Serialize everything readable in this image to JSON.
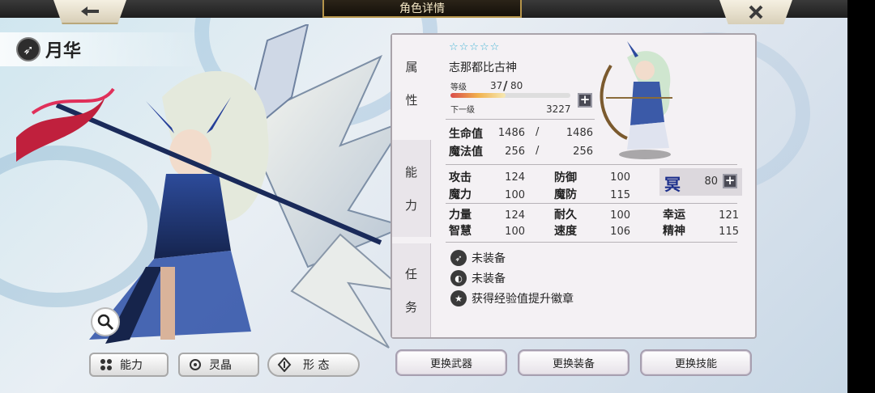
{
  "header": {
    "title": "角色详情",
    "back_icon": "arrow-left-icon",
    "close_icon": "close-icon"
  },
  "character": {
    "name": "月华",
    "class_icon": "bow-class-icon",
    "stars": "☆☆☆☆☆",
    "title": "志那都比古神",
    "level_label": "等级",
    "level": "37",
    "level_sep": "/",
    "level_max": "80",
    "next_label": "下一级",
    "next_exp": "3227",
    "exp_progress": 0.46
  },
  "vitals": {
    "hp_label": "生命值",
    "hp": "1486",
    "hp_sep": "/",
    "hp_max": "1486",
    "mp_label": "魔法值",
    "mp": "256",
    "mp_sep": "/",
    "mp_max": "256"
  },
  "stats": {
    "atk_label": "攻击",
    "atk": "124",
    "def_label": "防御",
    "def": "100",
    "mag_label": "魔力",
    "mag": "100",
    "mdef_label": "魔防",
    "mdef": "115",
    "str_label": "力量",
    "str": "124",
    "sta_label": "耐久",
    "sta": "100",
    "luck_label": "幸运",
    "luck": "121",
    "int_label": "智慧",
    "int": "100",
    "spd_label": "速度",
    "spd": "106",
    "spi_label": "精神",
    "spi": "115",
    "element_glyph": "冥",
    "element_value": "80"
  },
  "side_tabs": {
    "attr": [
      "属",
      "性"
    ],
    "ability": [
      "能",
      "力"
    ],
    "mission": [
      "任",
      "务"
    ]
  },
  "equipment": {
    "weapon": "未装备",
    "armor": "未装备",
    "badge": "获得经验值提升徽章"
  },
  "bottom_tabs": {
    "ability": "能力",
    "crystal": "灵晶",
    "form": "形 态"
  },
  "actions": {
    "weapon": "更换武器",
    "gear": "更换装备",
    "skill": "更换技能"
  },
  "colors": {
    "accent_gold": "#b5944a",
    "star_color": "#46b5d5",
    "panel_bg": "#f4f1f4"
  }
}
